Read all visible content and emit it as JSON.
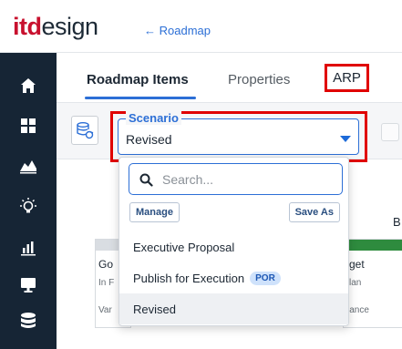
{
  "header": {
    "logo_it": "itd",
    "logo_design": "esign",
    "back_link": "← Roadmap"
  },
  "sidebar": {
    "items": [
      {
        "icon": "home-icon"
      },
      {
        "icon": "grid-icon"
      },
      {
        "icon": "area-chart-icon"
      },
      {
        "icon": "lightbulb-icon"
      },
      {
        "icon": "bar-chart-icon"
      },
      {
        "icon": "monitor-icon"
      },
      {
        "icon": "database-icon"
      }
    ]
  },
  "tabs": [
    {
      "label": "Roadmap Items",
      "active": true
    },
    {
      "label": "Properties",
      "active": false
    },
    {
      "label": "ARP",
      "active": false,
      "highlighted": true
    }
  ],
  "scenario": {
    "legend": "Scenario",
    "value": "Revised"
  },
  "dropdown": {
    "search_placeholder": "Search...",
    "manage_label": "Manage",
    "save_as_label": "Save As",
    "options": [
      {
        "label": "Executive Proposal",
        "badge": "",
        "selected": false
      },
      {
        "label": "Publish for Execution",
        "badge": "POR",
        "selected": false
      },
      {
        "label": "Revised",
        "badge": "",
        "selected": true
      }
    ]
  },
  "background": {
    "partial_b": "B",
    "left_card": {
      "title": "Go",
      "line1": "In F",
      "line2": "Var"
    },
    "right_card": {
      "title": "get",
      "line1": "lan",
      "line2": "iance"
    }
  },
  "colors": {
    "brand_red": "#c8102e",
    "accent_blue": "#2c6fd6",
    "sidebar_bg": "#162535",
    "highlight_red": "#e00000",
    "status_green": "#2e8b3e"
  }
}
